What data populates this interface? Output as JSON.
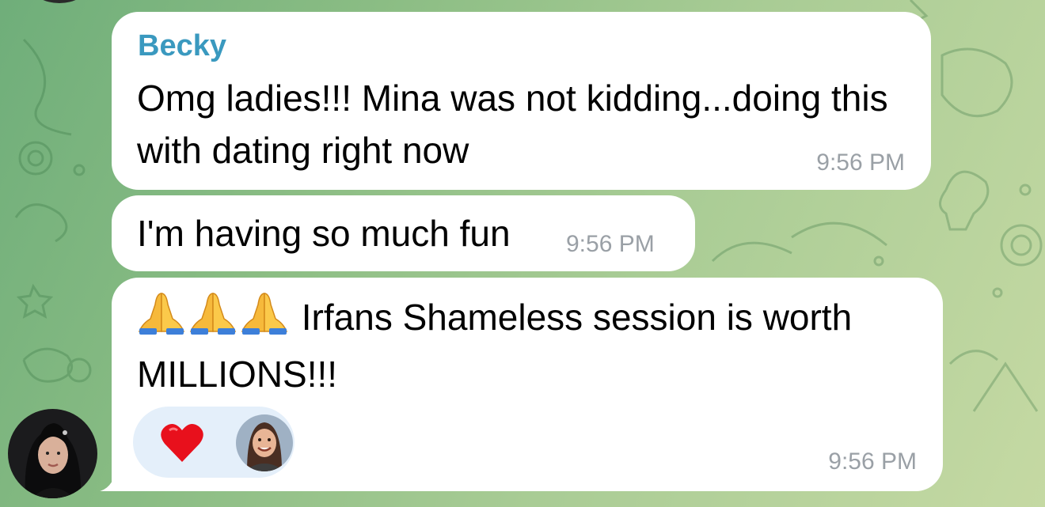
{
  "chat": {
    "background_colors": [
      "#6fae7a",
      "#c5d9a3"
    ],
    "messages": [
      {
        "sender": "Becky",
        "text": "Omg ladies!!! Mina was not kidding...doing this with dating right now",
        "time": "9:56 PM"
      },
      {
        "text": "I'm having so much fun",
        "time": "9:56 PM"
      },
      {
        "emoji_prefix": [
          "folded-hands-icon",
          "folded-hands-icon",
          "folded-hands-icon"
        ],
        "text": "Irfans Shameless session is worth MILLIONS!!!",
        "time": "9:56 PM",
        "reactions": [
          {
            "icon": "red-heart-icon",
            "reactor": "user-avatar"
          }
        ]
      }
    ],
    "sender_name_color": "#3a99bf",
    "reaction_pill_color": "#e4effa"
  }
}
